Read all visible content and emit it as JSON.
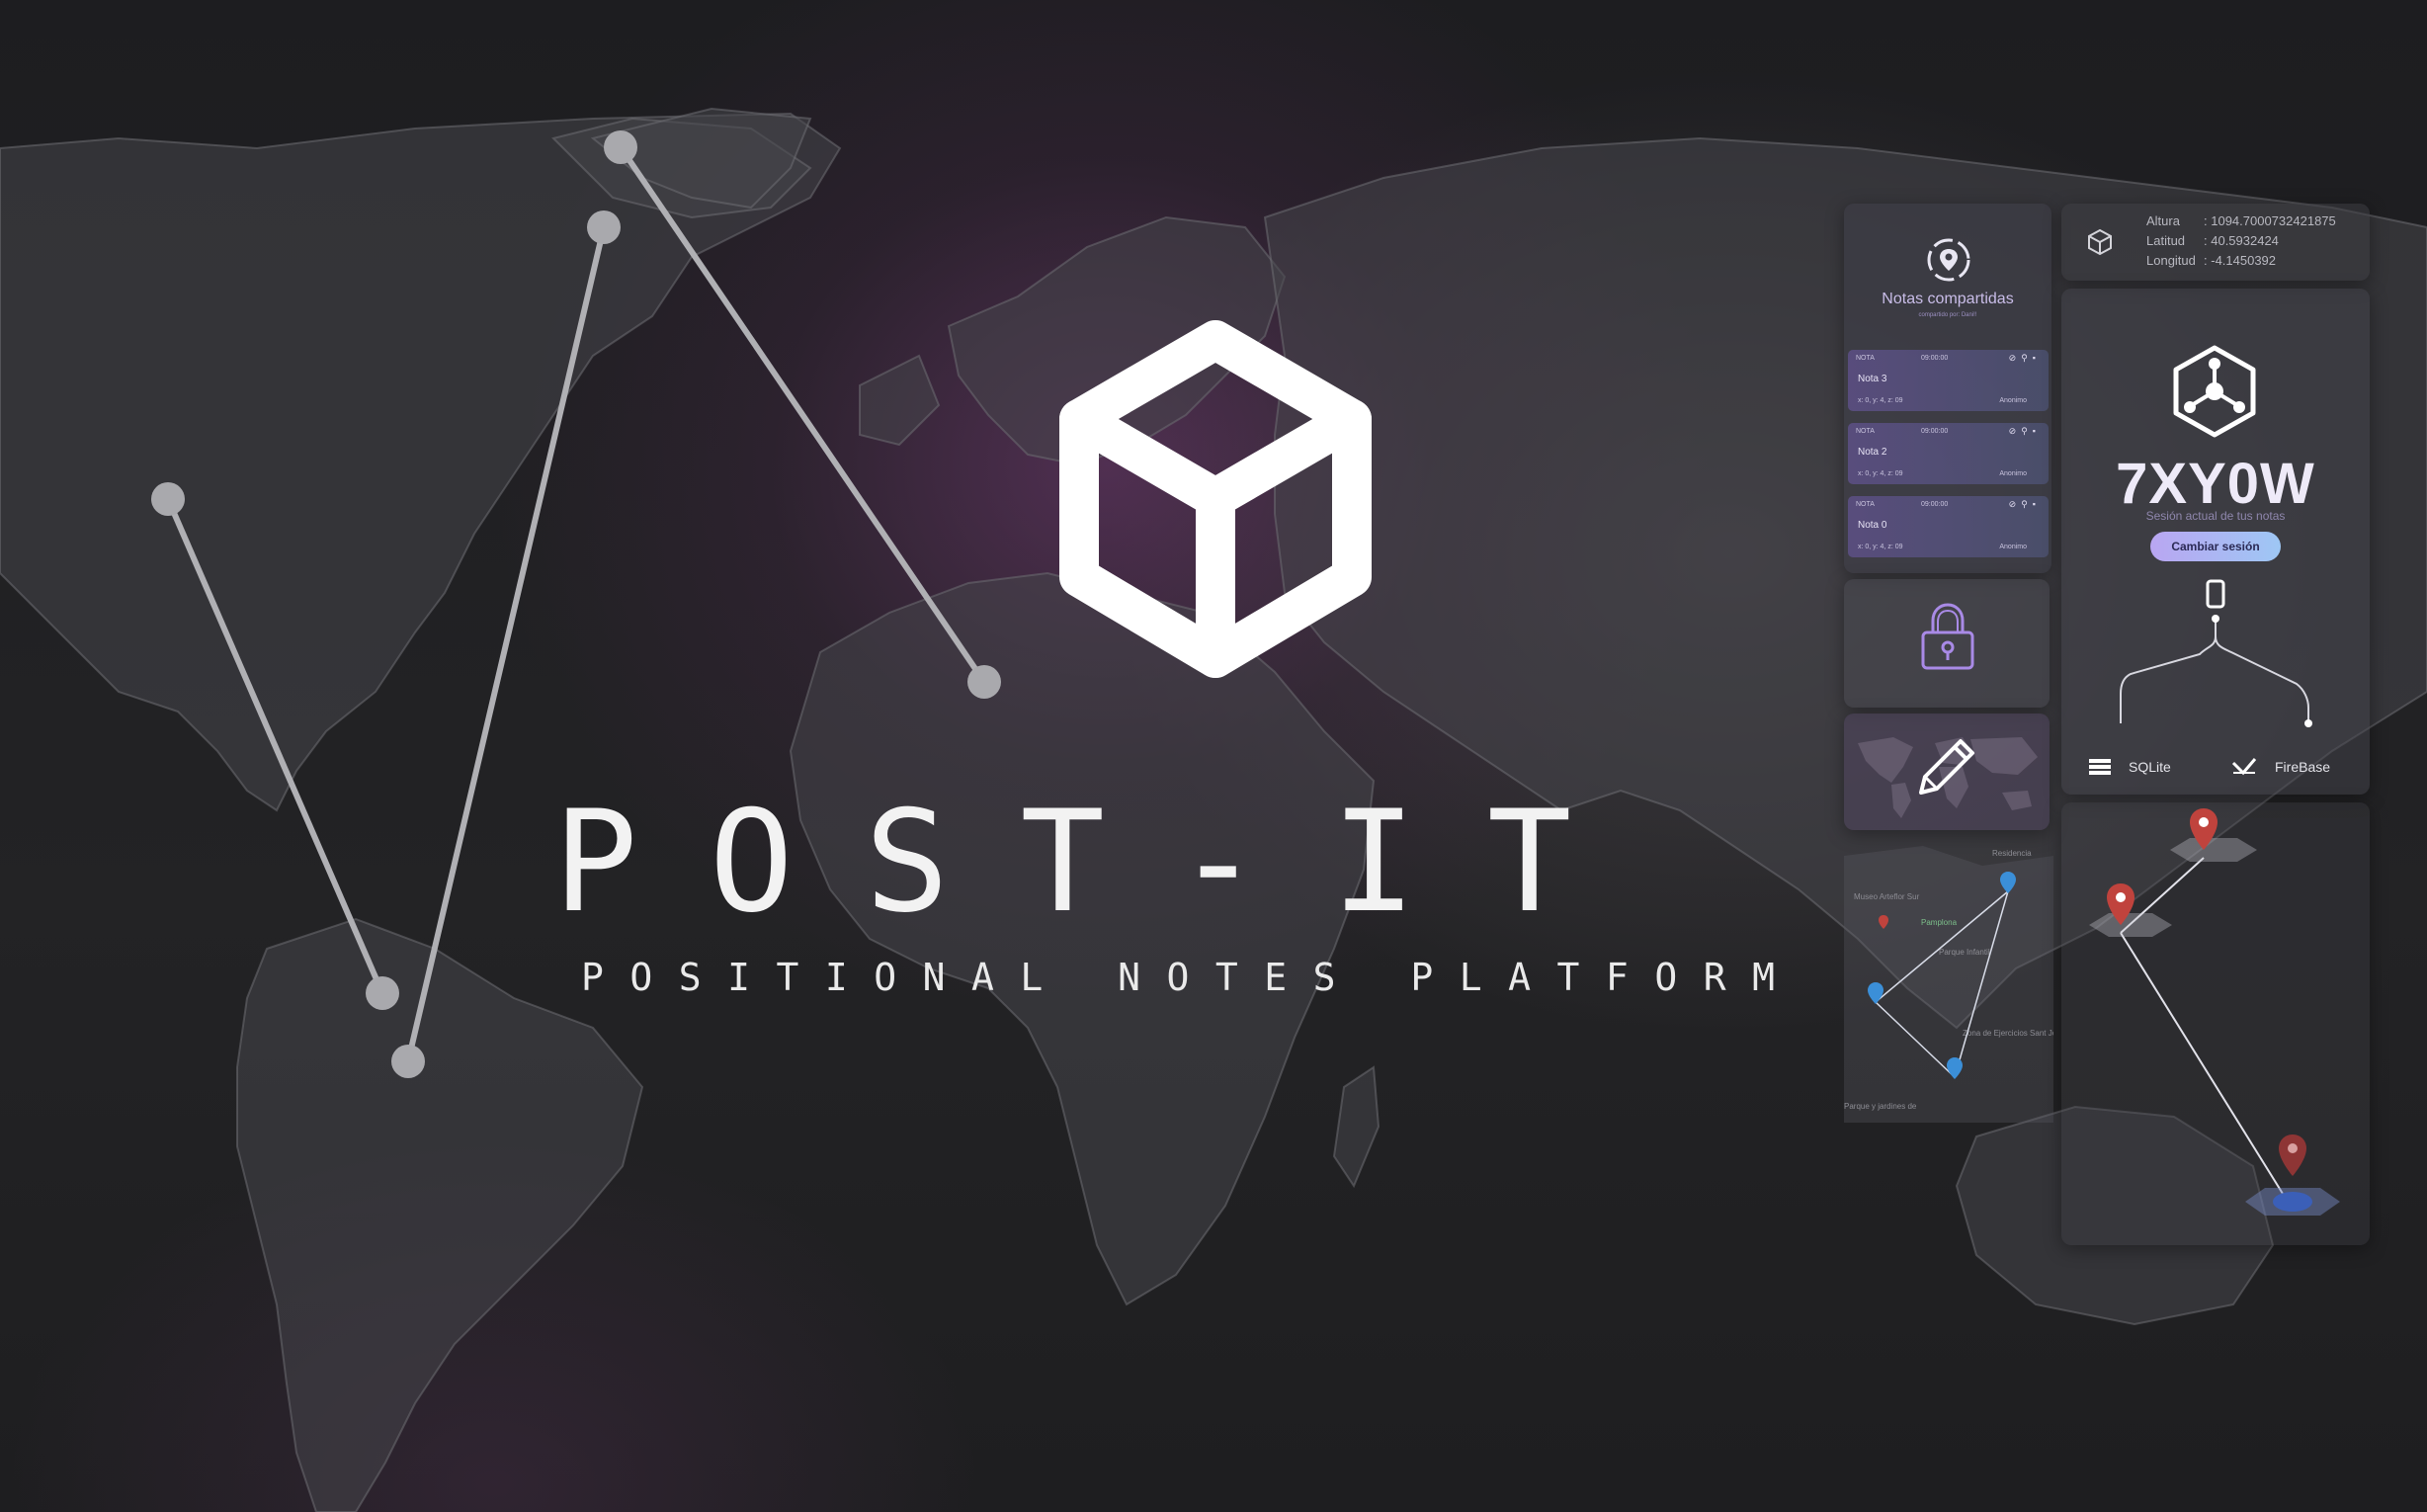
{
  "app": {
    "title": "POST-IT",
    "subtitle": "POSITIONAL NOTES PLATFORM"
  },
  "colors": {
    "accent_purple": "#9b7fe0",
    "button_gradient_start": "#b9a6f2",
    "button_gradient_end": "#9ec7f4",
    "pin_red": "#c0433d",
    "pin_blue": "#3b8fd8"
  },
  "icons": {
    "logo": "cube-icon",
    "shared_notes": "location-pin-icon",
    "lock": "lock-icon",
    "edit": "pencil-icon",
    "coords": "cube-outline-icon",
    "session": "hexagon-network-icon",
    "device": "smartphone-icon",
    "sqlite": "database-icon",
    "firebase": "firebase-icon"
  },
  "shared_notes": {
    "title": "Notas compartidas",
    "subtitle": "compartido por: Dani!!",
    "notes": [
      {
        "label": "NOTA",
        "time": "09:00:00",
        "title": "Nota 3",
        "coords": "x: 0, y: 4, z: 09",
        "author": "Anonimo"
      },
      {
        "label": "NOTA",
        "time": "09:00:00",
        "title": "Nota 2",
        "coords": "x: 0, y: 4, z: 09",
        "author": "Anonimo"
      },
      {
        "label": "NOTA",
        "time": "09:00:00",
        "title": "Nota 0",
        "coords": "x: 0, y: 4, z: 09",
        "author": "Anonimo"
      }
    ]
  },
  "mini_map": {
    "labels": [
      "Museo Arteflor Sur",
      "Pamplona",
      "Parque Infantil",
      "Residencia",
      "Zona de Ejercicios Sant Jordi",
      "Parque y jardines de"
    ]
  },
  "location": {
    "altura_label": "Altura",
    "altura_value": "1094.7000732421875",
    "latitud_label": "Latitud",
    "latitud_value": "40.5932424",
    "longitud_label": "Longitud",
    "longitud_value": "-4.1450392"
  },
  "session": {
    "code": "7XY0W",
    "subtitle": "Sesión actual de tus notas",
    "change_button": "Cambiar sesión",
    "sqlite_label": "SQLite",
    "firebase_label": "FireBase"
  }
}
